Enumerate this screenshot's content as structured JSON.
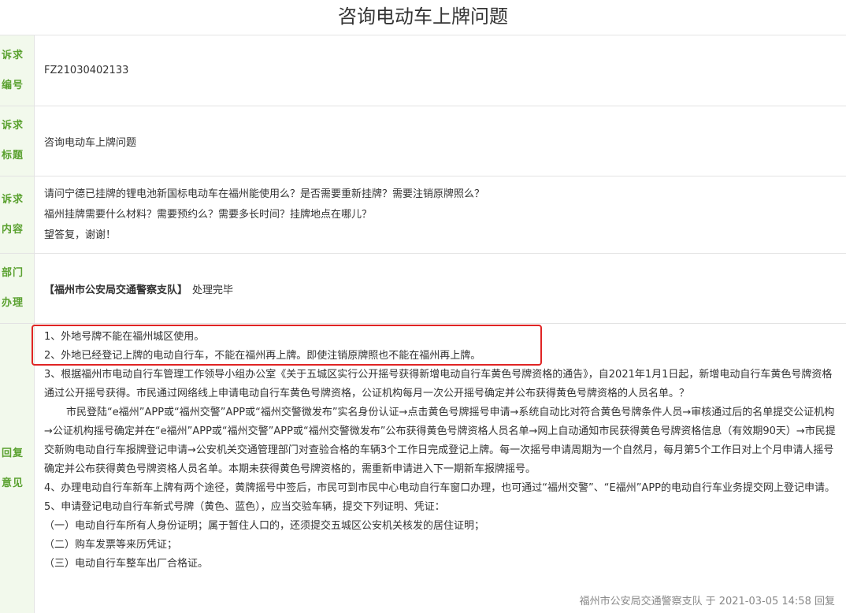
{
  "page": {
    "title": "咨询电动车上牌问题"
  },
  "fields": {
    "id": {
      "label_1": "诉求",
      "label_2": "编号",
      "value": "FZ21030402133"
    },
    "title": {
      "label_1": "诉求",
      "label_2": "标题",
      "value": "咨询电动车上牌问题"
    },
    "content": {
      "label_1": "诉求",
      "label_2": "内容",
      "lines": [
        "请问宁德已挂牌的锂电池新国标电动车在福州能使用么？是否需要重新挂牌？需要注销原牌照么？",
        "福州挂牌需要什么材料？需要预约么？需要多长时间？挂牌地点在哪儿？",
        "望答复，谢谢！"
      ]
    },
    "dept": {
      "label_1": "部门",
      "label_2": "办理",
      "name": "【福州市公安局交通警察支队】",
      "status": "处理完毕"
    },
    "reply": {
      "label_1": "回复",
      "label_2": "意见",
      "paragraphs": [
        "1、外地号牌不能在福州城区使用。",
        "2、外地已经登记上牌的电动自行车，不能在福州再上牌。即使注销原牌照也不能在福州再上牌。",
        "3、根据福州市电动自行车管理工作领导小组办公室《关于五城区实行公开摇号获得新增电动自行车黄色号牌资格的通告》，自2021年1月1日起，新增电动自行车黄色号牌资格通过公开摇号获得。市民通过网络线上申请电动自行车黄色号牌资格，公证机构每月一次公开摇号确定并公布获得黄色号牌资格的人员名单。？",
        "市民登陆“e福州”APP或“福州交警”APP或“福州交警微发布”实名身份认证→点击黄色号牌摇号申请→系统自动比对符合黄色号牌条件人员→审核通过后的名单提交公证机构→公证机构摇号确定并在“e福州”APP或“福州交警”APP或“福州交警微发布”公布获得黄色号牌资格人员名单→网上自动通知市民获得黄色号牌资格信息（有效期90天）→市民提交新购电动自行车报牌登记申请→公安机关交通管理部门对查验合格的车辆3个工作日完成登记上牌。每一次摇号申请周期为一个自然月，每月第5个工作日对上个月申请人摇号确定并公布获得黄色号牌资格人员名单。本期未获得黄色号牌资格的，需重新申请进入下一期新车报牌摇号。",
        "4、办理电动自行车新车上牌有两个途径，黄牌摇号中签后，市民可到市民中心电动自行车窗口办理，也可通过“福州交警”、“E福州”APP的电动自行车业务提交网上登记申请。",
        "5、申请登记电动自行车新式号牌（黄色、蓝色），应当交验车辆，提交下列证明、凭证：",
        "（一）电动自行车所有人身份证明；属于暂住人口的，还须提交五城区公安机关核发的居住证明；",
        "（二）购车发票等来历凭证；",
        "（三）电动自行车整车出厂合格证。"
      ],
      "footer_dept": "福州市公安局交通警察支队",
      "footer_at": "于",
      "footer_time": "2021-03-05 14:58",
      "footer_action": "回复"
    }
  },
  "colors": {
    "label_bg": "#f2f9ec",
    "label_text": "#5aa12f",
    "highlight_border": "#e02424"
  }
}
